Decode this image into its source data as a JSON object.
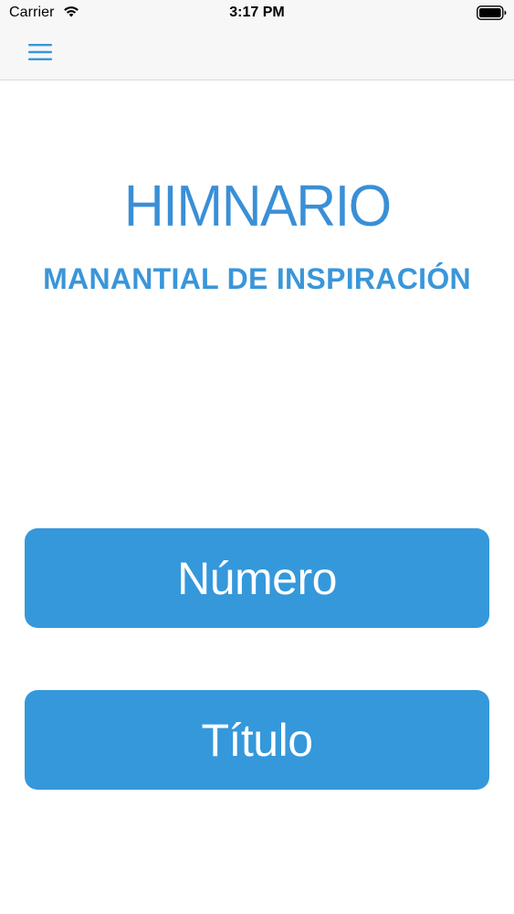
{
  "status_bar": {
    "carrier": "Carrier",
    "time": "3:17 PM",
    "wifi_icon": "wifi-icon",
    "battery_icon": "battery-icon"
  },
  "nav": {
    "menu_icon": "hamburger-menu-icon"
  },
  "header": {
    "title": "HIMNARIO",
    "subtitle": "MANANTIAL DE INSPIRACIÓN"
  },
  "buttons": {
    "number_label": "Número",
    "title_label": "Título"
  },
  "colors": {
    "accent": "#3598db",
    "title_text": "#3a8fd6",
    "nav_background": "#f7f7f7",
    "background": "#ffffff"
  }
}
